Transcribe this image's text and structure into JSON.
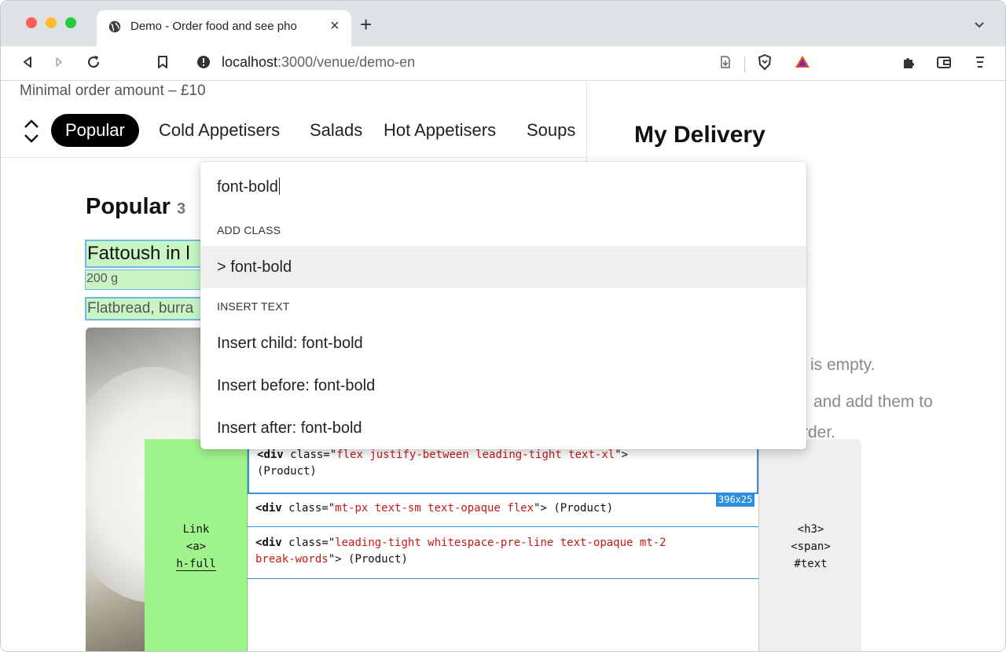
{
  "browser": {
    "tab_title": "Demo - Order food and see pho",
    "tab_close": "×",
    "new_tab": "+",
    "url_host": "localhost",
    "url_path": ":3000/venue/demo-en"
  },
  "venue": {
    "min_order": "Minimal order amount – £10",
    "categories": [
      "Popular",
      "Cold Appetisers",
      "Salads",
      "Hot Appetisers",
      "Soups"
    ],
    "section_title": "Popular",
    "section_count": "3",
    "product": {
      "name": "Fattoush in l",
      "weight": "200 g",
      "description": "Flatbread, burra"
    }
  },
  "cart": {
    "title": "My Delivery",
    "empty_line1": "is empty.",
    "empty_line2": "and add them to",
    "empty_line3": "rder."
  },
  "inspector": {
    "left_label": [
      "Link",
      "<a>",
      "h-full"
    ],
    "rows": [
      {
        "tag": "div",
        "cls": "flex justify-between leading-tight text-xl",
        "tail1": ">",
        "tail2": "(Product)"
      },
      {
        "tag": "div",
        "cls": "mt-px text-sm text-opaque flex",
        "tail1": "> (Product)"
      },
      {
        "tag": "div",
        "cls": "leading-tight whitespace-pre-line text-opaque mt-2",
        "cls2": "break-words",
        "tail1": "> (Product)"
      }
    ],
    "size_badge": "396x25",
    "right_label": [
      "<h3>",
      "<span>",
      "#text"
    ]
  },
  "palette": {
    "query": "font-bold",
    "section_add": "ADD CLASS",
    "add_item": "> font-bold",
    "section_insert": "INSERT TEXT",
    "insert_child": "Insert child: font-bold",
    "insert_before": "Insert before: font-bold",
    "insert_after": "Insert after: font-bold"
  }
}
